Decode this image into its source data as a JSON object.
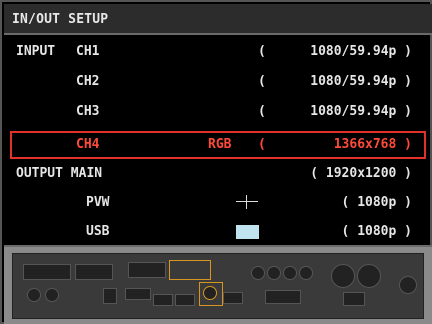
{
  "title": "IN/OUT SETUP",
  "input": {
    "label": "INPUT",
    "channels": [
      {
        "name": "CH1",
        "tag": "",
        "bracket": "(",
        "value": "1080/59.94p )"
      },
      {
        "name": "CH2",
        "tag": "",
        "bracket": "(",
        "value": "1080/59.94p )"
      },
      {
        "name": "CH3",
        "tag": "",
        "bracket": "(",
        "value": "1080/59.94p )"
      },
      {
        "name": "CH4",
        "tag": "RGB",
        "bracket": "(",
        "value": "1366x768 )"
      }
    ]
  },
  "output": {
    "label": "OUTPUT MAIN",
    "main_value": "( 1920x1200 )",
    "pvw_label": "PVW",
    "pvw_value": "( 1080p )",
    "usb_label": "USB",
    "usb_value": "( 1080p )"
  },
  "colors": {
    "selected": "#ff4a3a",
    "usb_swatch": "#bfe3ef"
  },
  "icons": {
    "pvw_swatch": "crosshair-icon",
    "usb_swatch": "color-swatch-icon",
    "rear_panel": "device-rear-panel-image"
  }
}
